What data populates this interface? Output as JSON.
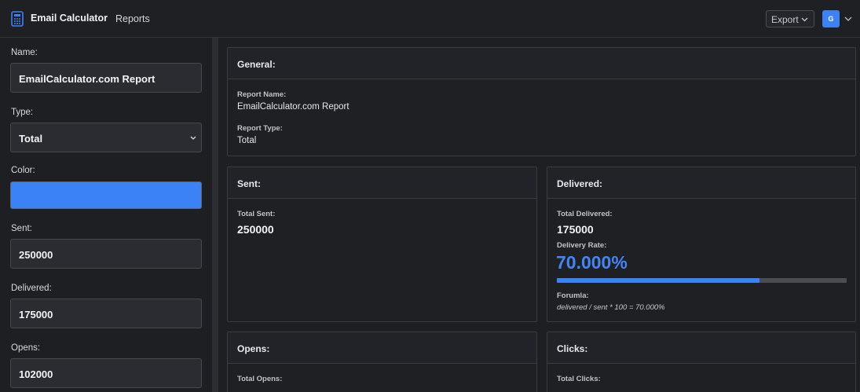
{
  "app": {
    "name": "Email Calculator",
    "nav_reports": "Reports",
    "export_label": "Export",
    "avatar_initial": "G"
  },
  "colors": {
    "accent": "#3b82f6",
    "background": "#1e1f23"
  },
  "sidebar": {
    "name_label": "Name:",
    "name_value": "EmailCalculator.com Report",
    "type_label": "Type:",
    "type_value": "Total",
    "color_label": "Color:",
    "color_value": "#3b82f6",
    "sent_label": "Sent:",
    "sent_value": "250000",
    "delivered_label": "Delivered:",
    "delivered_value": "175000",
    "opens_label": "Opens:",
    "opens_value": "102000"
  },
  "general": {
    "title": "General:",
    "report_name_label": "Report Name:",
    "report_name": "EmailCalculator.com Report",
    "report_type_label": "Report Type:",
    "report_type": "Total"
  },
  "sent": {
    "title": "Sent:",
    "total_label": "Total Sent:",
    "total": "250000"
  },
  "delivered": {
    "title": "Delivered:",
    "total_label": "Total Delivered:",
    "total": "175000",
    "rate_label": "Delivery Rate:",
    "rate": "70.000%",
    "rate_fraction": 0.7,
    "formula_label": "Forumla:",
    "formula": "delivered / sent * 100 = 70.000%"
  },
  "opens": {
    "title": "Opens:",
    "total_label": "Total Opens:"
  },
  "clicks": {
    "title": "Clicks:",
    "total_label": "Total Clicks:"
  }
}
